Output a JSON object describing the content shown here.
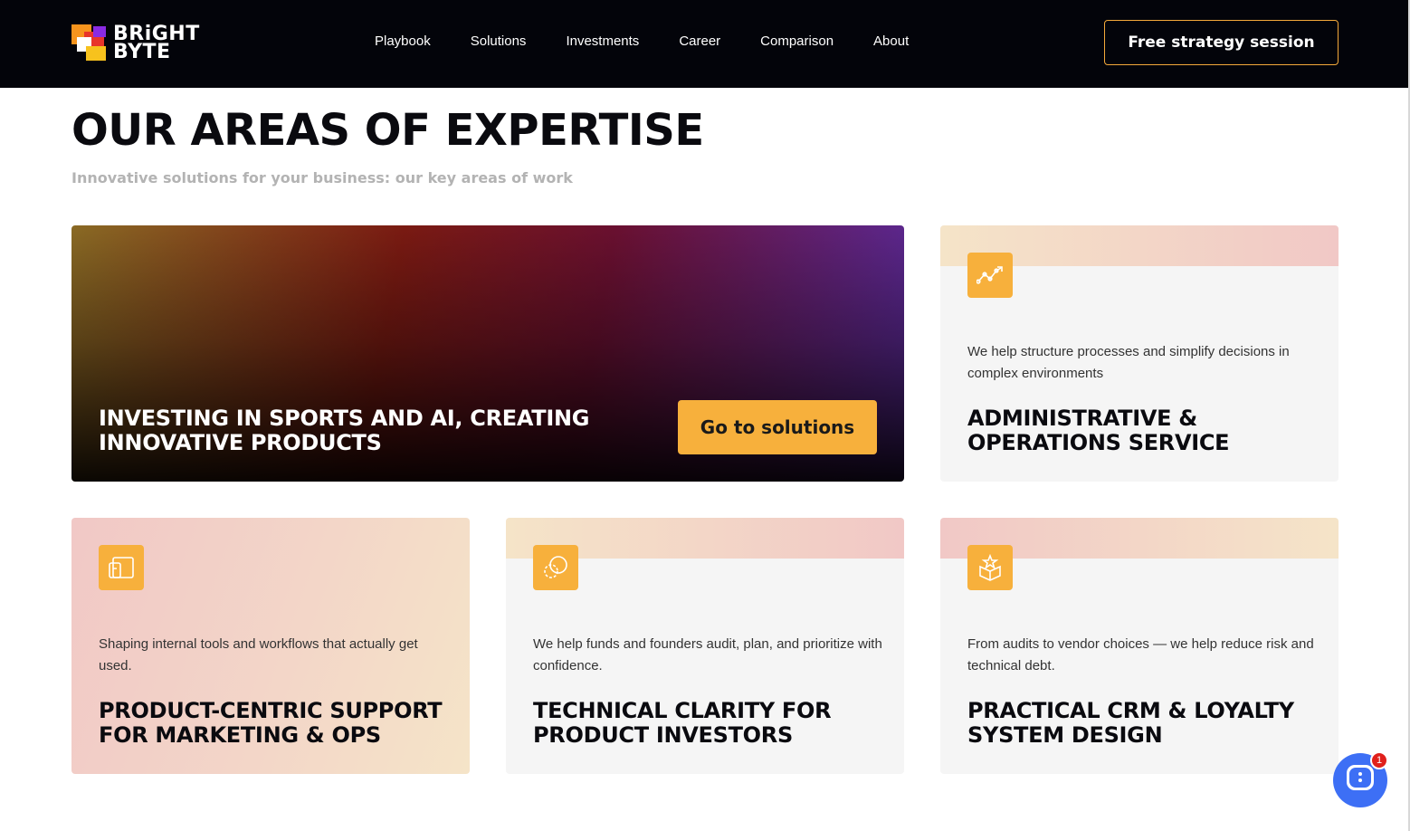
{
  "brand": {
    "logo_line1": "BRiGHT",
    "logo_line2": "BYTE",
    "accent": "#f7b03c"
  },
  "nav": {
    "items": [
      "Playbook",
      "Solutions",
      "Investments",
      "Career",
      "Comparison",
      "About"
    ],
    "cta_label": "Free strategy session"
  },
  "section": {
    "title": "OUR AREAS OF EXPERTISE",
    "subtitle": "Innovative solutions for your business: our key areas of work"
  },
  "hero": {
    "title": "INVESTING IN SPORTS AND AI, CREATING INNOVATIVE PRODUCTS",
    "button_label": "Go to solutions"
  },
  "cards": [
    {
      "icon": "growth-chart-icon",
      "description": "We help structure processes and simplify decisions in complex environments",
      "title": "ADMINISTRATIVE & OPERATIONS SERVICE"
    },
    {
      "icon": "devices-icon",
      "description": "Shaping internal tools and workflows that actually get used.",
      "title": "PRODUCT-CENTRIC SUPPORT FOR MARKETING & OPS"
    },
    {
      "icon": "circles-icon",
      "description": "We help funds and founders audit, plan, and prioritize with confidence.",
      "title": "TECHNICAL CLARITY FOR PRODUCT INVESTORS"
    },
    {
      "icon": "star-box-icon",
      "description": "From audits to vendor choices — we help reduce risk and technical debt.",
      "title": "PRACTICAL CRM & LOYALTY SYSTEM DESIGN"
    }
  ],
  "chat": {
    "badge_count": "1",
    "icon": "chat-icon"
  }
}
